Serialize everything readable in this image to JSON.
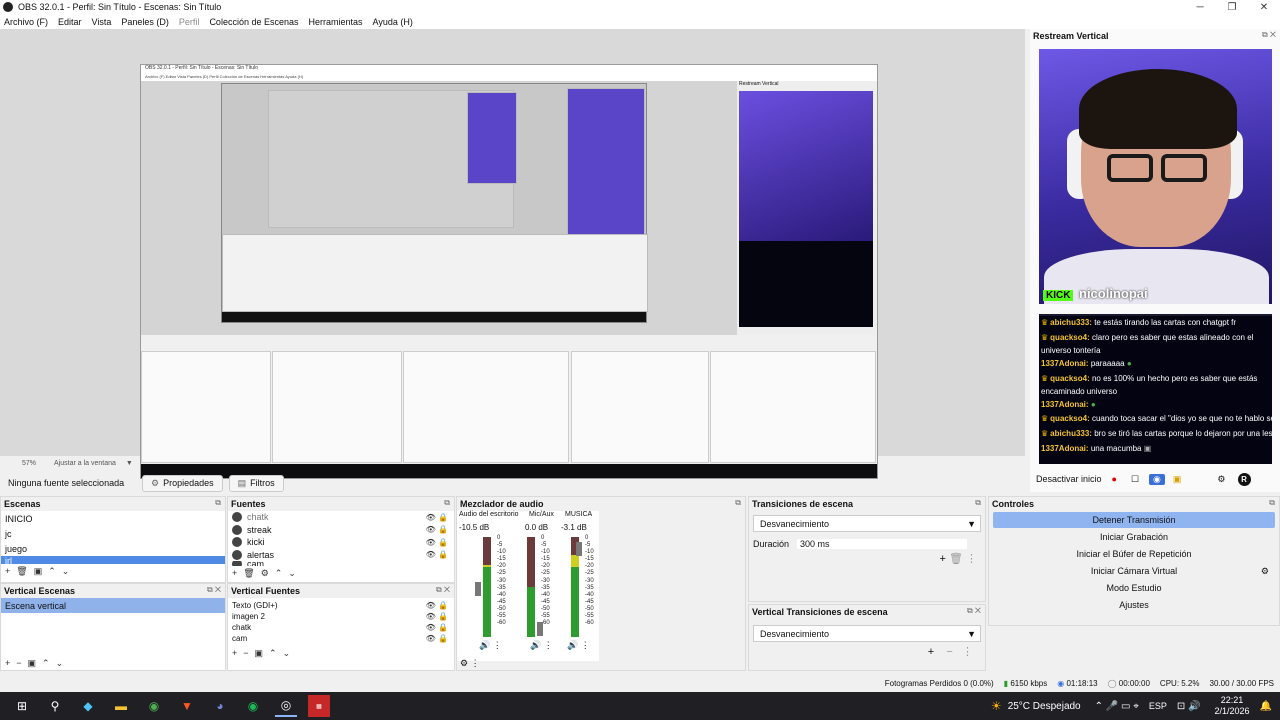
{
  "window": {
    "title": "OBS 32.0.1 - Perfil: Sin Título - Escenas: Sin Título",
    "min": "─",
    "max": "❐",
    "close": "✕"
  },
  "menu": [
    "Archivo (F)",
    "Editar",
    "Vista",
    "Paneles (D)",
    "Perfil",
    "Colección de Escenas",
    "Herramientas",
    "Ayuda (H)"
  ],
  "zoom": {
    "value": "57%",
    "fit": "Ajustar a la ventana"
  },
  "context": {
    "no_source": "Ninguna fuente seleccionada",
    "properties": "Propiedades",
    "filters": "Filtros"
  },
  "scenes": {
    "title": "Escenas",
    "items": [
      "INICIO",
      "jc",
      "juego",
      "irl"
    ]
  },
  "sources": {
    "title": "Fuentes",
    "items": [
      "chatk",
      "streak",
      "kicki",
      "alertas",
      "cam"
    ]
  },
  "vertical_scenes": {
    "title": "Vertical Escenas",
    "items": [
      "Escena vertical"
    ]
  },
  "vertical_sources": {
    "title": "Vertical Fuentes",
    "items": [
      "Texto (GDI+)",
      "imagen 2",
      "chatk",
      "cam"
    ]
  },
  "mixer": {
    "title": "Mezclador de audio",
    "channels": [
      {
        "name": "Audio del escritorio",
        "db": "-10.5 dB",
        "level": 0.72
      },
      {
        "name": "Mic/Aux",
        "db": "0.0 dB",
        "level": 0.5
      },
      {
        "name": "MUSICA",
        "db": "-3.1 dB",
        "level": 0.82
      }
    ],
    "scale": [
      "0",
      "-5",
      "-10",
      "-15",
      "-20",
      "-25",
      "-30",
      "-35",
      "-40",
      "-45",
      "-50",
      "-55",
      "-60"
    ]
  },
  "transitions": {
    "title": "Transiciones de escena",
    "selected": "Desvanecimiento",
    "duration_label": "Duración",
    "duration": "300 ms"
  },
  "vertical_transitions": {
    "title": "Vertical Transiciones de escena",
    "selected": "Desvanecimiento"
  },
  "controls": {
    "title": "Controles",
    "buttons": [
      "Detener Transmisión",
      "Iniciar Grabación",
      "Iniciar el Búfer de Repetición",
      "Iniciar Cámara Virtual",
      "Modo Estudio",
      "Ajustes"
    ]
  },
  "restream": {
    "title": "Restream Vertical",
    "streamer": "nicolinopai",
    "badge": "KICK",
    "chat": [
      {
        "user": "abichu333:",
        "msg": "te estás tirando las cartas con chatgpt fr"
      },
      {
        "user": "quackso4:",
        "msg": "claro pero es saber que estas alineado con el universo tontería"
      },
      {
        "user": "1337Adonai:",
        "msg": "paraaaaa"
      },
      {
        "user": "quackso4:",
        "msg": "no es 100% un hecho pero es saber que estás encaminado universo"
      },
      {
        "user": "1337Adonai:",
        "msg": ""
      },
      {
        "user": "quackso4:",
        "msg": "cuando toca sacar el \"dios yo se que no te hablo seguido\""
      },
      {
        "user": "abichu333:",
        "msg": "bro se tiró las cartas porque lo dejaron por una lesbiana"
      },
      {
        "user": "1337Adonai:",
        "msg": "una macumba"
      }
    ],
    "deactivate": "Desactivar inicio"
  },
  "status": {
    "dropped": "Fotogramas Perdidos 0 (0.0%)",
    "kbps": "6150 kbps",
    "stream_time": "01:18:13",
    "rec_time": "00:00:00",
    "cpu": "CPU: 5.2%",
    "fps": "30.00 / 30.00 FPS"
  },
  "taskbar": {
    "weather": "25°C  Despejado",
    "lang": "ESP",
    "time": "22:21",
    "date": "2/1/2026"
  }
}
